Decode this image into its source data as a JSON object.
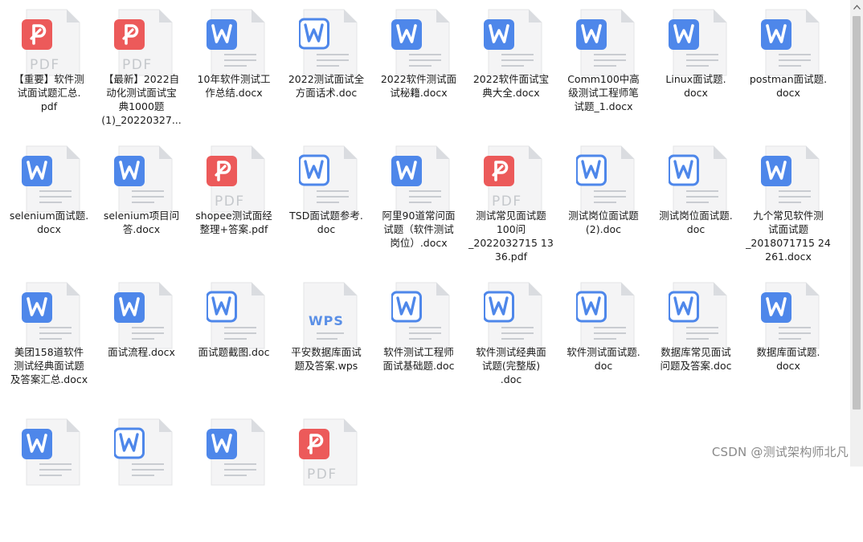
{
  "files": [
    {
      "name": "【重要】软件测试面试题汇总.pdf",
      "lines": [
        "【重要】软件测",
        "试面试题汇总.",
        "pdf"
      ],
      "type": "pdf"
    },
    {
      "name": "【最新】2022自动化测试面试宝典1000题(1)_20220327...",
      "lines": [
        "【最新】2022自",
        "动化测试面试宝",
        "典1000题",
        "(1)_20220327..."
      ],
      "type": "pdf"
    },
    {
      "name": "10年软件测试工作总结.docx",
      "lines": [
        "10年软件测试工",
        "作总结.docx"
      ],
      "type": "word"
    },
    {
      "name": "2022测试面试全方面话术.doc",
      "lines": [
        "2022测试面试全",
        "方面话术.doc"
      ],
      "type": "word-outline"
    },
    {
      "name": "2022软件测试面试秘籍.docx",
      "lines": [
        "2022软件测试面",
        "试秘籍.docx"
      ],
      "type": "word"
    },
    {
      "name": "2022软件面试宝典大全.docx",
      "lines": [
        "2022软件面试宝",
        "典大全.docx"
      ],
      "type": "word"
    },
    {
      "name": "Comm100中高级测试工程师笔试题_1.docx",
      "lines": [
        "Comm100中高",
        "级测试工程师笔",
        "试题_1.docx"
      ],
      "type": "word"
    },
    {
      "name": "Linux面试题.docx",
      "lines": [
        "Linux面试题.",
        "docx"
      ],
      "type": "word"
    },
    {
      "name": "postman面试题.docx",
      "lines": [
        "postman面试题.",
        "docx"
      ],
      "type": "word"
    },
    {
      "name": "selenium面试题.docx",
      "lines": [
        "selenium面试题.",
        "docx"
      ],
      "type": "word"
    },
    {
      "name": "selenium项目问答.docx",
      "lines": [
        "selenium项目问",
        "答.docx"
      ],
      "type": "word"
    },
    {
      "name": "shopee测试面经整理+答案.pdf",
      "lines": [
        "shopee测试面经",
        "整理+答案.pdf"
      ],
      "type": "pdf"
    },
    {
      "name": "TSD面试题参考.doc",
      "lines": [
        "TSD面试题参考.",
        "doc"
      ],
      "type": "word-outline"
    },
    {
      "name": "阿里90道常问面试题（软件测试岗位）.docx",
      "lines": [
        "阿里90道常问面",
        "试题（软件测试",
        "岗位）.docx"
      ],
      "type": "word"
    },
    {
      "name": "测试常见面试题100问_20220327151336.pdf",
      "lines": [
        "测试常见面试题",
        "100问",
        "_2022032715 13",
        "36.pdf"
      ],
      "type": "pdf"
    },
    {
      "name": "测试岗位面试题(2).doc",
      "lines": [
        "测试岗位面试题",
        "(2).doc"
      ],
      "type": "word-outline"
    },
    {
      "name": "测试岗位面试题.doc",
      "lines": [
        "测试岗位面试题.",
        "doc"
      ],
      "type": "word-outline"
    },
    {
      "name": "九个常见软件测试面试题_201807171524261.docx",
      "lines": [
        "九个常见软件测",
        "试面试题",
        "_2018071715 24",
        "261.docx"
      ],
      "type": "word"
    },
    {
      "name": "美团158道软件测试经典面试题及答案汇总.docx",
      "lines": [
        "美团158道软件",
        "测试经典面试题",
        "及答案汇总.docx"
      ],
      "type": "word"
    },
    {
      "name": "面试流程.docx",
      "lines": [
        "面试流程.docx"
      ],
      "type": "word"
    },
    {
      "name": "面试题截图.doc",
      "lines": [
        "面试题截图.doc"
      ],
      "type": "word-outline"
    },
    {
      "name": "平安数据库面试题及答案.wps",
      "lines": [
        "平安数据库面试",
        "题及答案.wps"
      ],
      "type": "wps"
    },
    {
      "name": "软件测试工程师面试基础题.doc",
      "lines": [
        "软件测试工程师",
        "面试基础题.doc"
      ],
      "type": "word-outline"
    },
    {
      "name": "软件测试经典面试题(完整版).doc",
      "lines": [
        "软件测试经典面",
        "试题(完整版)",
        ".doc"
      ],
      "type": "word-outline"
    },
    {
      "name": "软件测试面试题.doc",
      "lines": [
        "软件测试面试题.",
        "doc"
      ],
      "type": "word-outline"
    },
    {
      "name": "数据库常见面试问题及答案.doc",
      "lines": [
        "数据库常见面试",
        "问题及答案.doc"
      ],
      "type": "word-outline"
    },
    {
      "name": "数据库面试题.docx",
      "lines": [
        "数据库面试题.",
        "docx"
      ],
      "type": "word"
    },
    {
      "name": "",
      "lines": [],
      "type": "word"
    },
    {
      "name": "",
      "lines": [],
      "type": "word-outline"
    },
    {
      "name": "",
      "lines": [],
      "type": "word"
    },
    {
      "name": "",
      "lines": [],
      "type": "pdf"
    }
  ],
  "icon_labels": {
    "pdf": "PDF",
    "wps": "WPS"
  },
  "colors": {
    "word": "#4e87ea",
    "pdf": "#ec5a5a",
    "wps": "#5a8fe6",
    "page": "#f4f4f5",
    "fold": "#dadce0",
    "lines": "#c9ccd1"
  },
  "watermark": "CSDN @测试架构师北凡"
}
